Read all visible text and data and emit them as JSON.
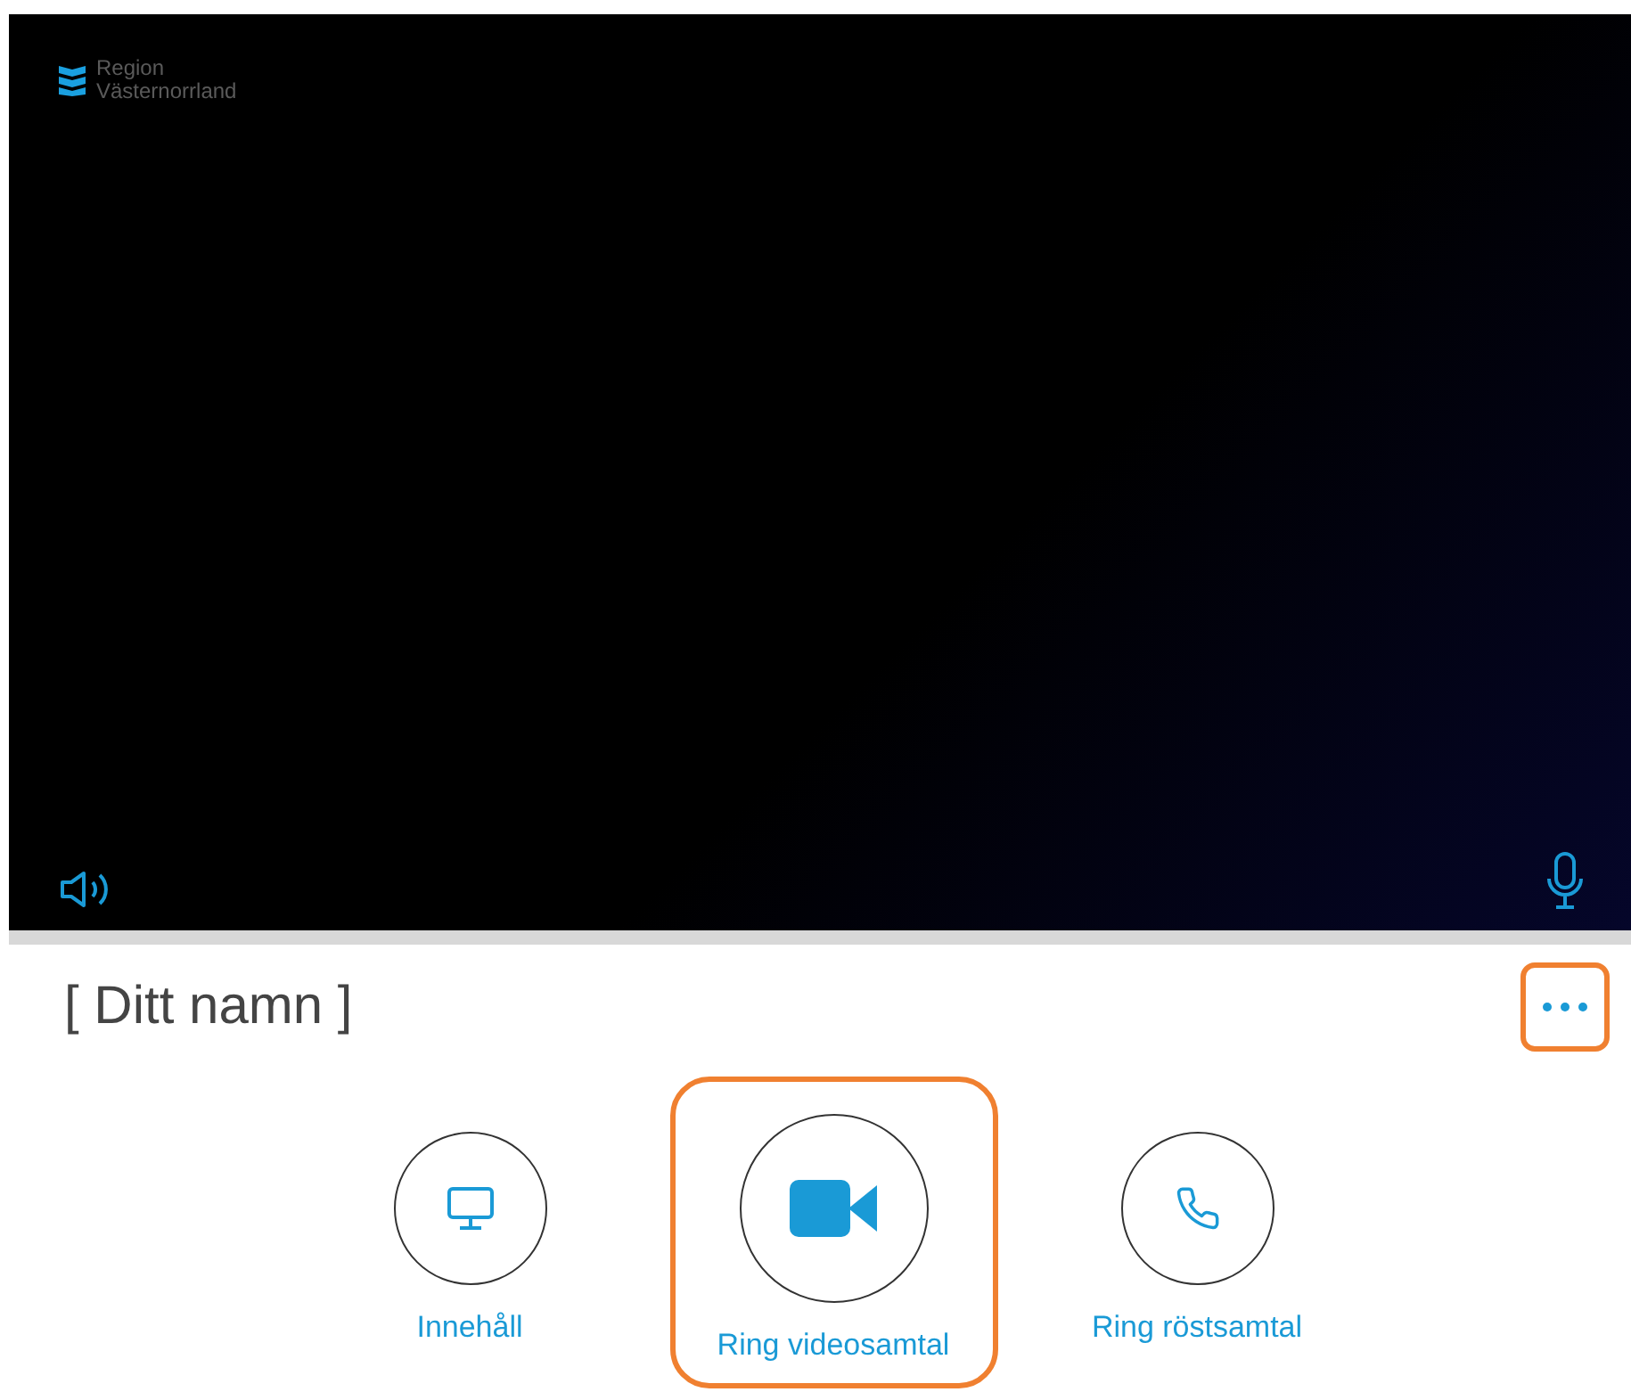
{
  "video": {
    "logo": {
      "line_1": "Region",
      "line_2": "Västernorrland"
    }
  },
  "caller": {
    "name": "[ Ditt namn ]",
    "more_button": {
      "highlighted": true
    }
  },
  "actions": [
    {
      "label": "Innehåll",
      "kind": "screen",
      "primary": false,
      "highlighted": false
    },
    {
      "label": "Ring videosamtal",
      "kind": "video",
      "primary": true,
      "highlighted": true
    },
    {
      "label": "Ring röstsamtal",
      "kind": "phone",
      "primary": false,
      "highlighted": false
    }
  ]
}
